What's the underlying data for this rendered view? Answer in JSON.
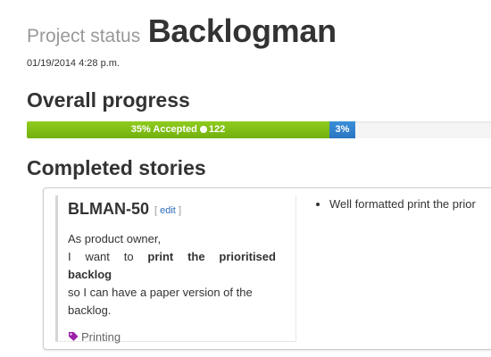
{
  "header": {
    "label": "Project status",
    "project_name": "Backlogman"
  },
  "timestamp": "01/19/2014 4:28 p.m.",
  "progress": {
    "title": "Overall progress",
    "accepted_label": "35% Accepted",
    "accepted_points": "122",
    "accepted_fraction": 0.35,
    "other_label": "3%",
    "other_fraction": 0.03,
    "colors": {
      "accepted": "#7cbd14",
      "other": "#2f80cc",
      "track": "#f5f5f5"
    }
  },
  "completed": {
    "title": "Completed stories",
    "stories": [
      {
        "id": "BLMAN-50",
        "edit_open": "[",
        "edit_label": "edit",
        "edit_close": "]",
        "text_line1": "As product owner,",
        "text_i_want": "I",
        "text_want": "want",
        "text_to": "to",
        "text_bold1": "print",
        "text_bold2": "the",
        "text_bold3": "prioritised",
        "text_bold4": "backlog",
        "text_line4": "so I can have a paper version of the",
        "text_line5": "backlog.",
        "tag": "Printing",
        "tag_icon": "tag-icon",
        "tag_color": "#9b1fa8",
        "acceptance_criteria": [
          "Well formatted print the prior"
        ]
      }
    ]
  }
}
